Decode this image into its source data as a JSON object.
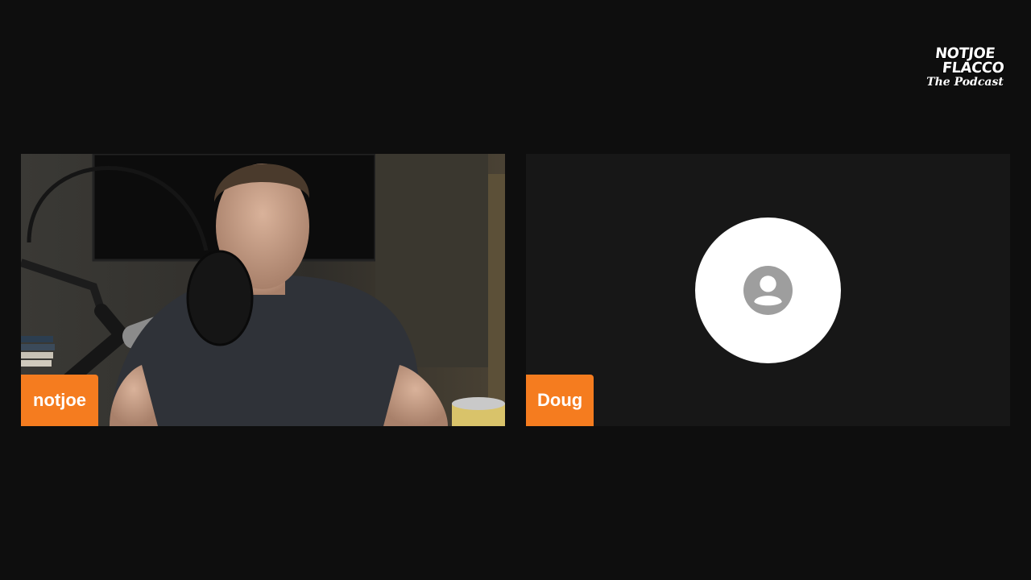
{
  "logo": {
    "line1": "NOTJOE",
    "line2": "FLACCO",
    "line3": "The Podcast"
  },
  "participants": [
    {
      "name": "notjoe",
      "video": "camera-on"
    },
    {
      "name": "Doug",
      "video": "camera-off",
      "icon": "user-avatar-icon"
    }
  ],
  "colors": {
    "background": "#0e0e0e",
    "tile_off": "#171717",
    "name_tag": "#f57c1f",
    "avatar_bg": "#ffffff",
    "avatar_icon": "#9e9e9e"
  }
}
